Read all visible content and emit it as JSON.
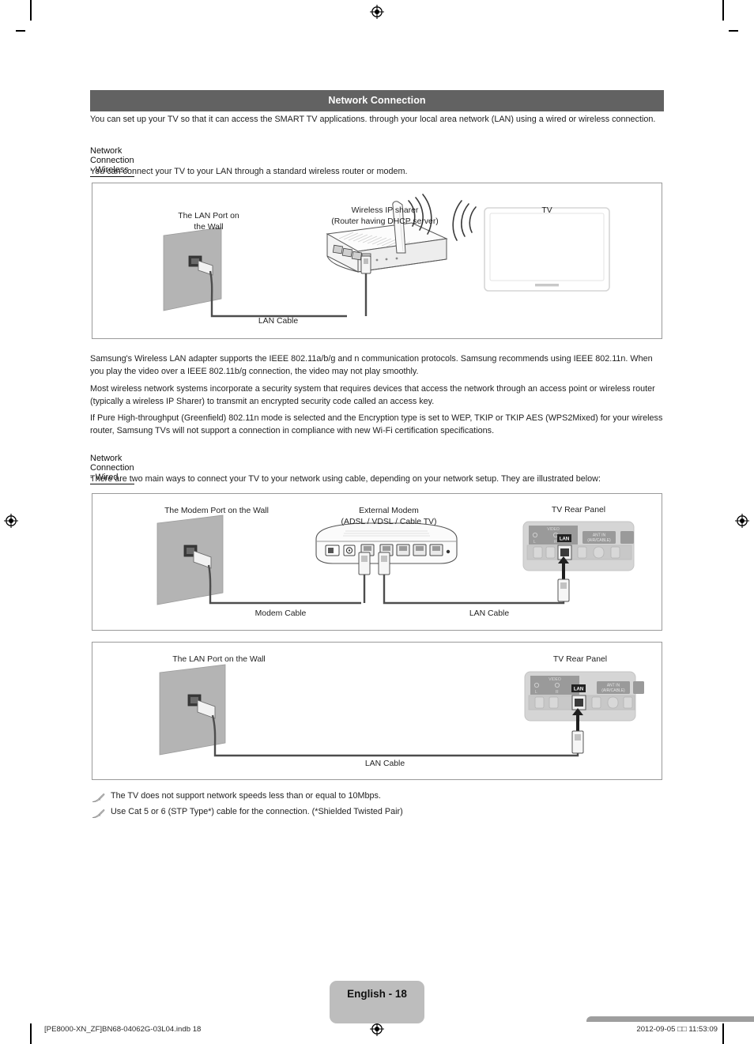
{
  "section": {
    "title": "Network Connection",
    "intro": "You can set up your TV so that it can access the SMART TV applications. through your local area network (LAN) using a wired or wireless connection."
  },
  "wireless": {
    "heading": "Network Connection - Wireless",
    "lead": "You can connect your TV to your LAN through a standard wireless router or modem.",
    "diagram": {
      "wall_label_line1": "The LAN Port on",
      "wall_label_line2": "the Wall",
      "router_label_line1": "Wireless IP sharer",
      "router_label_line2": "(Router having DHCP server)",
      "tv_label": "TV",
      "cable_label": "LAN Cable"
    },
    "paragraphs": [
      "Samsung's Wireless LAN adapter supports the IEEE 802.11a/b/g and n communication protocols. Samsung recommends using IEEE 802.11n. When you play the video over a IEEE 802.11b/g connection, the video may not play smoothly.",
      "Most wireless network systems incorporate a security system that requires devices that access the network through an access point or wireless router (typically a wireless IP Sharer) to transmit an encrypted security code called an access key.",
      "If Pure High-throughput (Greenfield) 802.11n mode is selected and the Encryption type is set to WEP, TKIP or TKIP AES (WPS2Mixed) for your wireless router, Samsung TVs will not support a connection in compliance with new Wi-Fi certification specifications."
    ]
  },
  "wired": {
    "heading": "Network Connection - Wired",
    "lead": "There are two main ways to connect your TV to your network using cable, depending on your network setup. They are illustrated below:",
    "diagram_modem": {
      "wall_label": "The Modem Port on the Wall",
      "modem_label_line1": "External Modem",
      "modem_label_line2": "(ADSL / VDSL / Cable TV)",
      "tv_panel_label": "TV Rear Panel",
      "modem_cable_label": "Modem Cable",
      "lan_cable_label": "LAN Cable",
      "port_lan": "LAN",
      "port_ant_line1": "ANT IN",
      "port_ant_line2": "(AIR/CABLE)",
      "port_video": "VIDEO"
    },
    "diagram_lan": {
      "wall_label": "The LAN Port on the Wall",
      "tv_panel_label": "TV Rear Panel",
      "lan_cable_label": "LAN Cable",
      "port_lan": "LAN",
      "port_ant_line1": "ANT IN",
      "port_ant_line2": "(AIR/CABLE)",
      "port_video": "VIDEO"
    }
  },
  "notes": [
    "The TV does not support network speeds less than or equal to 10Mbps.",
    "Use Cat 5 or 6 (STP Type*) cable for the connection. (*Shielded Twisted Pair)"
  ],
  "footer": {
    "page_label": "English - 18",
    "file_ref": "[PE8000-XN_ZF]BN68-04062G-03L04.indb   18",
    "timestamp": "2012-09-05   □□ 11:53:09"
  },
  "colors": {
    "header_bar": "#626262",
    "page_box": "#bdbdbd",
    "wall": "#b4b4b4",
    "cable": "#4d4d4d"
  }
}
